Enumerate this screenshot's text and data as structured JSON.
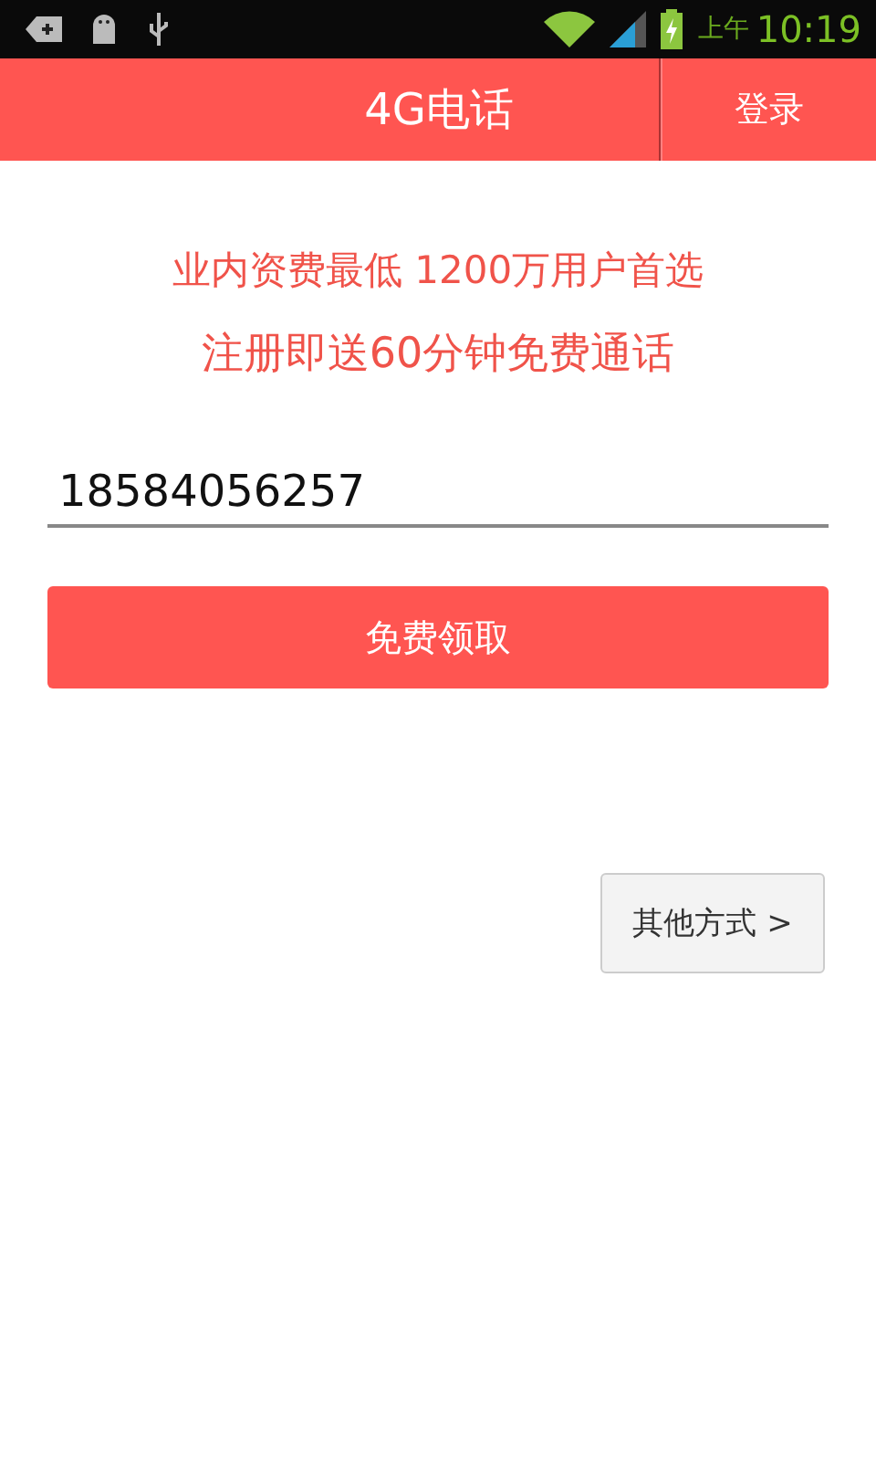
{
  "status_bar": {
    "am_pm": "上午",
    "time": "10:19"
  },
  "app_bar": {
    "title": "4G电话",
    "login": "登录"
  },
  "promo": [
    "业内资费最低 1200万用户首选",
    "注册即送60分钟免费通话"
  ],
  "phone_field": {
    "value": "18584056257"
  },
  "claim_button": "免费领取",
  "other_button": "其他方式 >"
}
